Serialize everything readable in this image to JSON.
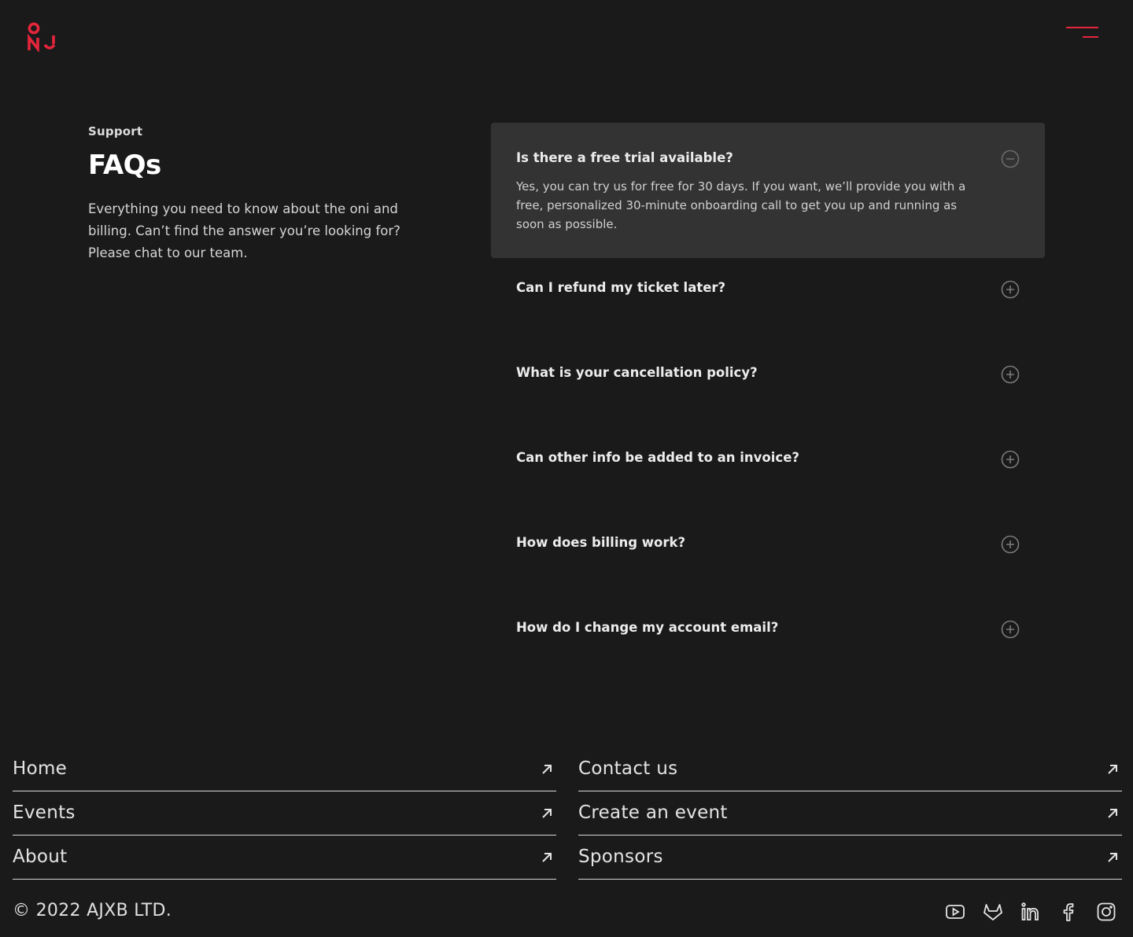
{
  "brand": {
    "logo_text": "ONJ",
    "accent_color": "#e4263c",
    "logo_icon": "oni-logo-icon",
    "menu_icon": "hamburger-menu-icon"
  },
  "intro": {
    "eyebrow": "Support",
    "title": "FAQs",
    "description": "Everything you need to know about the oni and billing. Can’t find the answer you’re looking for? Please chat to our team."
  },
  "faqs": [
    {
      "question": "Is there a free trial available?",
      "answer": "Yes, you can try us for free for 30 days. If you want, we’ll provide you with a free, personalized 30-minute onboarding call to get you up and running as soon as possible.",
      "expanded": true,
      "icon": "minus-circle-icon"
    },
    {
      "question": "Can I refund my ticket later?",
      "expanded": false,
      "icon": "plus-circle-icon"
    },
    {
      "question": "What is your cancellation policy?",
      "expanded": false,
      "icon": "plus-circle-icon"
    },
    {
      "question": "Can other info be added to an invoice?",
      "expanded": false,
      "icon": "plus-circle-icon"
    },
    {
      "question": "How does billing work?",
      "expanded": false,
      "icon": "plus-circle-icon"
    },
    {
      "question": "How do I change my account email?",
      "expanded": false,
      "icon": "plus-circle-icon"
    }
  ],
  "footer": {
    "links_left": [
      {
        "label": "Home",
        "icon": "arrow-up-right-icon"
      },
      {
        "label": "Events",
        "icon": "arrow-up-right-icon"
      },
      {
        "label": "About",
        "icon": "arrow-up-right-icon"
      }
    ],
    "links_right": [
      {
        "label": "Contact us",
        "icon": "arrow-up-right-icon"
      },
      {
        "label": "Create an event",
        "icon": "arrow-up-right-icon"
      },
      {
        "label": "Sponsors",
        "icon": "arrow-up-right-icon"
      }
    ],
    "copyright": "© 2022 AJXB LTD.",
    "socials": [
      "youtube-icon",
      "gitlab-icon",
      "linkedin-icon",
      "facebook-icon",
      "instagram-icon"
    ]
  }
}
